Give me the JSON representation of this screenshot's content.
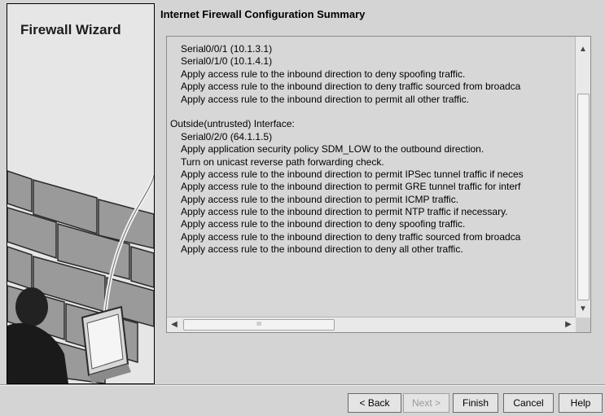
{
  "sidebar": {
    "wizard_title": "Firewall Wizard"
  },
  "header": {
    "title": "Internet Firewall Configuration Summary"
  },
  "summary_lines": [
    {
      "text": "Serial0/0/1 (10.1.3.1)",
      "indent": true
    },
    {
      "text": "Serial0/1/0 (10.1.4.1)",
      "indent": true
    },
    {
      "text": "Apply access rule to the inbound direction to deny spoofing traffic.",
      "indent": true
    },
    {
      "text": "Apply access rule to the inbound direction to deny traffic sourced from broadca",
      "indent": true
    },
    {
      "text": "Apply access rule to the inbound direction to permit all other traffic.",
      "indent": true
    },
    {
      "text": "",
      "indent": false
    },
    {
      "text": "Outside(untrusted) Interface:",
      "indent": false
    },
    {
      "text": "Serial0/2/0 (64.1.1.5)",
      "indent": true
    },
    {
      "text": "Apply application security policy SDM_LOW to the outbound direction.",
      "indent": true
    },
    {
      "text": "Turn on unicast reverse path forwarding check.",
      "indent": true
    },
    {
      "text": "Apply access rule to the inbound direction to permit IPSec tunnel traffic if neces",
      "indent": true
    },
    {
      "text": "Apply access rule to the inbound direction to permit GRE tunnel traffic for interf",
      "indent": true
    },
    {
      "text": "Apply access rule to the inbound direction to permit ICMP traffic.",
      "indent": true
    },
    {
      "text": "Apply access rule to the inbound direction to permit NTP traffic if necessary.",
      "indent": true
    },
    {
      "text": "Apply access rule to the inbound direction to deny spoofing traffic.",
      "indent": true
    },
    {
      "text": "Apply access rule to the inbound direction to deny traffic sourced from broadca",
      "indent": true
    },
    {
      "text": "Apply access rule to the inbound direction to deny all other traffic.",
      "indent": true
    }
  ],
  "scroll": {
    "up_icon": "▲",
    "down_icon": "▼",
    "left_icon": "◀",
    "right_icon": "▶",
    "thumb_grip": "III"
  },
  "buttons": {
    "back": "< Back",
    "next": "Next >",
    "finish": "Finish",
    "cancel": "Cancel",
    "help": "Help"
  }
}
